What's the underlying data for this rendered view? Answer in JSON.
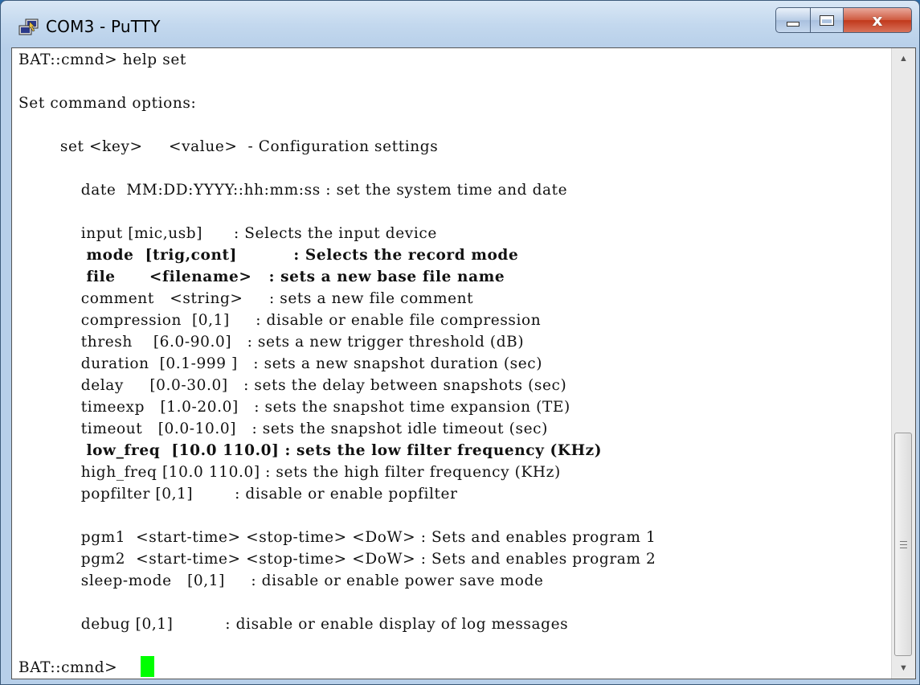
{
  "window": {
    "title": "COM3 - PuTTY",
    "controls": {
      "minimize": "minimize",
      "maximize": "maximize",
      "close": "x"
    }
  },
  "terminal": {
    "lines": [
      "BAT::cmnd> help set",
      "",
      "Set command options:",
      "",
      "        set <key>     <value>  - Configuration settings",
      "",
      "            date  MM:DD:YYYY::hh:mm:ss : set the system time and date",
      "",
      "            input [mic,usb]      : Selects the input device",
      "            mode  [trig,cont]          : Selects the record mode",
      "            file      <filename>   : sets a new base file name",
      "            comment   <string>     : sets a new file comment",
      "            compression  [0,1]     : disable or enable file compression",
      "            thresh    [6.0-90.0]   : sets a new trigger threshold (dB)",
      "            duration  [0.1-999 ]   : sets a new snapshot duration (sec)",
      "            delay     [0.0-30.0]   : sets the delay between snapshots (sec)",
      "            timeexp   [1.0-20.0]   : sets the snapshot time expansion (TE)",
      "            timeout   [0.0-10.0]   : sets the snapshot idle timeout (sec)",
      "            low_freq  [10.0 110.0] : sets the low filter frequency (KHz)",
      "            high_freq [10.0 110.0] : sets the high filter frequency (KHz)",
      "            popfilter [0,1]        : disable or enable popfilter",
      "",
      "            pgm1  <start-time> <stop-time> <DoW> : Sets and enables program 1",
      "            pgm2  <start-time> <stop-time> <DoW> : Sets and enables program 2",
      "            sleep-mode   [0,1]     : disable or enable power save mode",
      "",
      "            debug [0,1]          : disable or enable display of log messages",
      "",
      "BAT::cmnd> "
    ],
    "cursor_color": "#00ff00"
  },
  "scrollbar": {
    "up_arrow": "▲",
    "down_arrow": "▼"
  }
}
